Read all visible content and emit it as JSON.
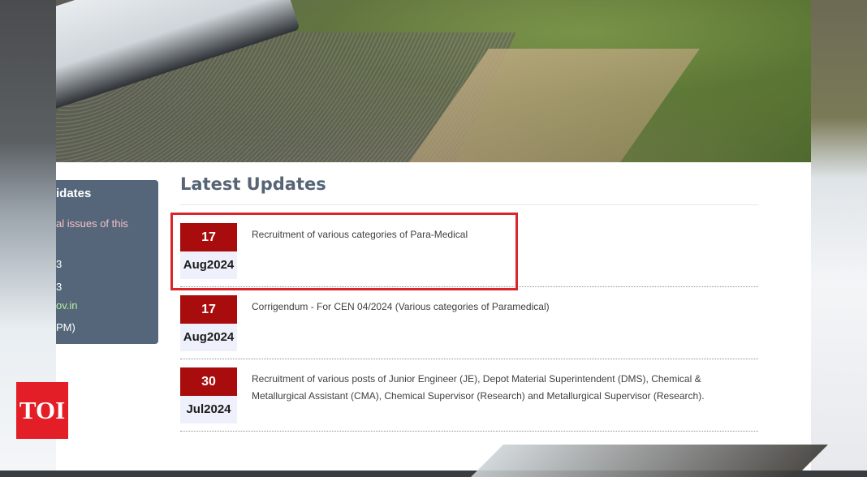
{
  "sidebar": {
    "title_fragment": "idates",
    "issue_fragment": "al issues of this",
    "line1": "3",
    "line2": "3",
    "email_fragment": "ov.in",
    "time_fragment": "PM)"
  },
  "main": {
    "heading": "Latest Updates",
    "updates": [
      {
        "day": "17",
        "month_year": "Aug2024",
        "text": "Recruitment of various categories of Para-Medical"
      },
      {
        "day": "17",
        "month_year": "Aug2024",
        "text": "Corrigendum - For CEN 04/2024 (Various categories of Paramedical)"
      },
      {
        "day": "30",
        "month_year": "Jul2024",
        "text": "Recruitment of various posts of Junior Engineer (JE), Depot Material Superintendent (DMS), Chemical & Metallurgical Assistant (CMA), Chemical Supervisor (Research) and Metallurgical Supervisor (Research)."
      }
    ]
  },
  "logo": {
    "text": "TOI",
    "color": "#e41e26"
  },
  "colors": {
    "accent_red": "#a80c0c",
    "panel": "#55667a",
    "heading": "#566474",
    "highlight": "#d8262b"
  }
}
